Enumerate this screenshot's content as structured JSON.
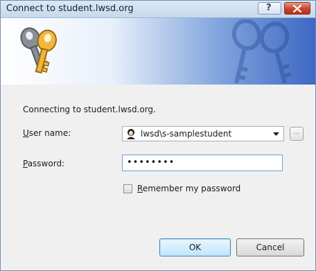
{
  "window": {
    "title": "Connect to student.lwsd.org",
    "help_symbol": "?"
  },
  "icons": {
    "banner": "keys-icon",
    "avatar": "user-avatar-icon",
    "help": "help-icon",
    "close": "close-icon"
  },
  "dialog": {
    "connecting_text": "Connecting to student.lwsd.org.",
    "username_label_mnemonic": "U",
    "username_label_rest": "ser name:",
    "username_value": "lwsd\\s-samplestudent",
    "browse_label": "...",
    "password_label_mnemonic": "P",
    "password_label_rest": "assword:",
    "password_value": "••••••••",
    "remember_mnemonic": "R",
    "remember_rest": "emember my password",
    "remember_checked": false,
    "ok_label": "OK",
    "cancel_label": "Cancel"
  },
  "colors": {
    "banner_start": "#ffffff",
    "banner_end": "#3e68c4",
    "close_button": "#c8442f",
    "focus_border": "#6f9cd9"
  }
}
